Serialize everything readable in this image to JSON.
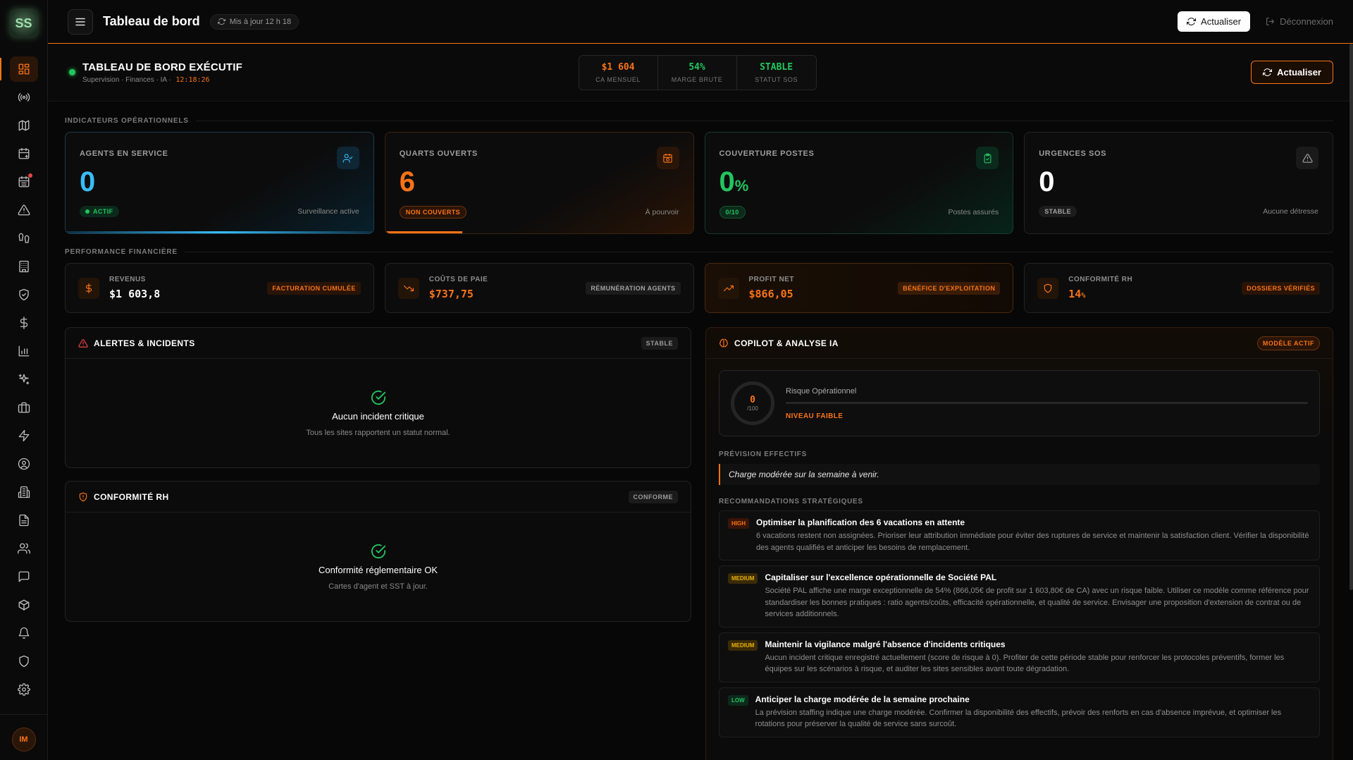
{
  "topbar": {
    "title": "Tableau de bord",
    "update_status": "Mis à jour 12 h 18",
    "refresh_label": "Actualiser",
    "logout_label": "Déconnexion"
  },
  "user": {
    "initials": "IM"
  },
  "logo": {
    "text": "SS"
  },
  "colors": {
    "accent": "#f97316",
    "success": "#22c55e",
    "info": "#38bdf8"
  },
  "sidebar": {
    "items": [
      {
        "name": "dashboard",
        "icon": "grid-icon",
        "active": true
      },
      {
        "name": "live",
        "icon": "broadcast-icon"
      },
      {
        "name": "map",
        "icon": "map-icon"
      },
      {
        "name": "calendar-plus",
        "icon": "calendar-plus-icon"
      },
      {
        "name": "schedule",
        "icon": "calendar-list-icon",
        "notification": true
      },
      {
        "name": "alerts",
        "icon": "warning-icon"
      },
      {
        "name": "patrol",
        "icon": "footprints-icon"
      },
      {
        "name": "buildings",
        "icon": "building-icon"
      },
      {
        "name": "security",
        "icon": "shield-check-icon"
      },
      {
        "name": "finance",
        "icon": "dollar-icon"
      },
      {
        "name": "reports",
        "icon": "bar-chart-icon"
      },
      {
        "name": "ai",
        "icon": "sparkles-icon"
      },
      {
        "name": "jobs",
        "icon": "briefcase-icon"
      },
      {
        "name": "activity",
        "icon": "bolt-icon"
      },
      {
        "name": "profile",
        "icon": "user-circle-icon"
      },
      {
        "name": "sites",
        "icon": "office-icon"
      },
      {
        "name": "documents",
        "icon": "file-icon"
      },
      {
        "name": "team",
        "icon": "users-icon"
      },
      {
        "name": "messages",
        "icon": "message-icon"
      },
      {
        "name": "packages",
        "icon": "box-icon"
      },
      {
        "name": "notifications",
        "icon": "bell-icon"
      },
      {
        "name": "protection",
        "icon": "shield-icon"
      },
      {
        "name": "settings",
        "icon": "gear-icon"
      }
    ]
  },
  "exec": {
    "title": "TABLEAU DE BORD EXÉCUTIF",
    "subtitle": "Supervision · Finances · IA ·",
    "clock": "12:18:26",
    "kpis": [
      {
        "value": "$1 604",
        "label": "CA MENSUEL",
        "color": "#f97316"
      },
      {
        "value": "54%",
        "label": "MARGE BRUTE",
        "color": "#22c55e"
      },
      {
        "value": "STABLE",
        "label": "STATUT SOS",
        "color": "#22c55e"
      }
    ],
    "refresh_label": "Actualiser"
  },
  "operational": {
    "section_label": "INDICATEURS OPÉRATIONNELS",
    "cards": [
      {
        "label": "AGENTS EN SERVICE",
        "value": "0",
        "badge": "ACTIF",
        "note": "Surveillance active"
      },
      {
        "label": "QUARTS OUVERTS",
        "value": "6",
        "badge": "NON COUVERTS",
        "note": "À pourvoir"
      },
      {
        "label": "COUVERTURE POSTES",
        "value": "0",
        "unit": "%",
        "badge": "0/10",
        "note": "Postes assurés"
      },
      {
        "label": "URGENCES SOS",
        "value": "0",
        "badge": "STABLE",
        "note": "Aucune détresse"
      }
    ]
  },
  "financial": {
    "section_label": "PERFORMANCE FINANCIÈRE",
    "cards": [
      {
        "label": "REVENUS",
        "value": "$1 603,8",
        "badge": "FACTURATION CUMULÉE"
      },
      {
        "label": "COÛTS DE PAIE",
        "value": "$737,75",
        "badge": "RÉMUNÉRATION AGENTS"
      },
      {
        "label": "PROFIT NET",
        "value": "$866,05",
        "badge": "BÉNÉFICE D'EXPLOITATION"
      },
      {
        "label": "CONFORMITÉ RH",
        "value": "14",
        "unit": "%",
        "badge": "DOSSIERS VÉRIFIÉS"
      }
    ]
  },
  "alerts_panel": {
    "title": "ALERTES & INCIDENTS",
    "tag": "STABLE",
    "empty_title": "Aucun incident critique",
    "empty_sub": "Tous les sites rapportent un statut normal."
  },
  "hr_panel": {
    "title": "CONFORMITÉ RH",
    "tag": "CONFORME",
    "empty_title": "Conformité réglementaire OK",
    "empty_sub": "Cartes d'agent et SST à jour."
  },
  "ai_panel": {
    "title": "COPILOT & ANALYSE IA",
    "tag": "MODÈLE ACTIF",
    "risk": {
      "score": "0",
      "max": "/100",
      "label": "Risque Opérationnel",
      "level": "NIVEAU FAIBLE",
      "fraction": 0
    },
    "forecast_label": "PRÉVISION EFFECTIFS",
    "forecast_text": "Charge modérée sur la semaine à venir.",
    "reco_label": "RECOMMANDATIONS STRATÉGIQUES",
    "recommendations": [
      {
        "priority": "HIGH",
        "title": "Optimiser la planification des 6 vacations en attente",
        "text": "6 vacations restent non assignées. Prioriser leur attribution immédiate pour éviter des ruptures de service et maintenir la satisfaction client. Vérifier la disponibilité des agents qualifiés et anticiper les besoins de remplacement."
      },
      {
        "priority": "MEDIUM",
        "title": "Capitaliser sur l'excellence opérationnelle de Société PAL",
        "text": "Société PAL affiche une marge exceptionnelle de 54% (866,05€ de profit sur 1 603,80€ de CA) avec un risque faible. Utiliser ce modèle comme référence pour standardiser les bonnes pratiques : ratio agents/coûts, efficacité opérationnelle, et qualité de service. Envisager une proposition d'extension de contrat ou de services additionnels."
      },
      {
        "priority": "MEDIUM",
        "title": "Maintenir la vigilance malgré l'absence d'incidents critiques",
        "text": "Aucun incident critique enregistré actuellement (score de risque à 0). Profiter de cette période stable pour renforcer les protocoles préventifs, former les équipes sur les scénarios à risque, et auditer les sites sensibles avant toute dégradation."
      },
      {
        "priority": "LOW",
        "title": "Anticiper la charge modérée de la semaine prochaine",
        "text": "La prévision staffing indique une charge modérée. Confirmer la disponibilité des effectifs, prévoir des renforts en cas d'absence imprévue, et optimiser les rotations pour préserver la qualité de service sans surcoût."
      }
    ]
  }
}
